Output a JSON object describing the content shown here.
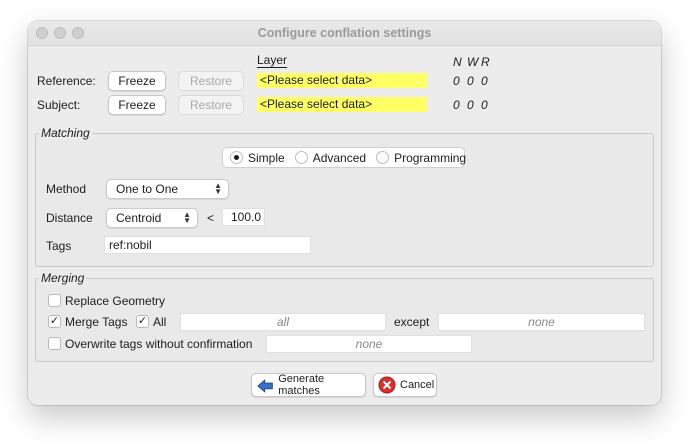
{
  "window": {
    "title": "Configure conflation settings"
  },
  "layers": {
    "layer_header": "Layer",
    "nwr_headers": [
      "N",
      "W",
      "R"
    ],
    "freeze_label": "Freeze",
    "restore_label": "Restore",
    "reference": {
      "label": "Reference:",
      "layer": "<Please select data>",
      "counts": [
        "0",
        "0",
        "0"
      ]
    },
    "subject": {
      "label": "Subject:",
      "layer": "<Please select data>",
      "counts": [
        "0",
        "0",
        "0"
      ]
    },
    "highlight_color": "#ffff66"
  },
  "matching": {
    "title": "Matching",
    "modes": [
      "Simple",
      "Advanced",
      "Programming"
    ],
    "selected_mode": "Simple",
    "method_label": "Method",
    "method_value": "One to One",
    "distance_label": "Distance",
    "distance_value": "Centroid",
    "distance_operator": "<",
    "distance_threshold": "100.0",
    "tags_label": "Tags",
    "tags_value": "ref:nobil"
  },
  "merging": {
    "title": "Merging",
    "replace_geometry": {
      "label": "Replace Geometry",
      "checked": false
    },
    "merge_tags": {
      "label": "Merge Tags",
      "checked": true
    },
    "all": {
      "label": "All",
      "checked": true
    },
    "all_field_value": "all",
    "except_label": "except",
    "except_field_value": "none",
    "overwrite": {
      "label": "Overwrite tags without confirmation",
      "checked": false
    },
    "overwrite_field_value": "none"
  },
  "footer": {
    "generate_label": "Generate matches",
    "cancel_label": "Cancel"
  }
}
